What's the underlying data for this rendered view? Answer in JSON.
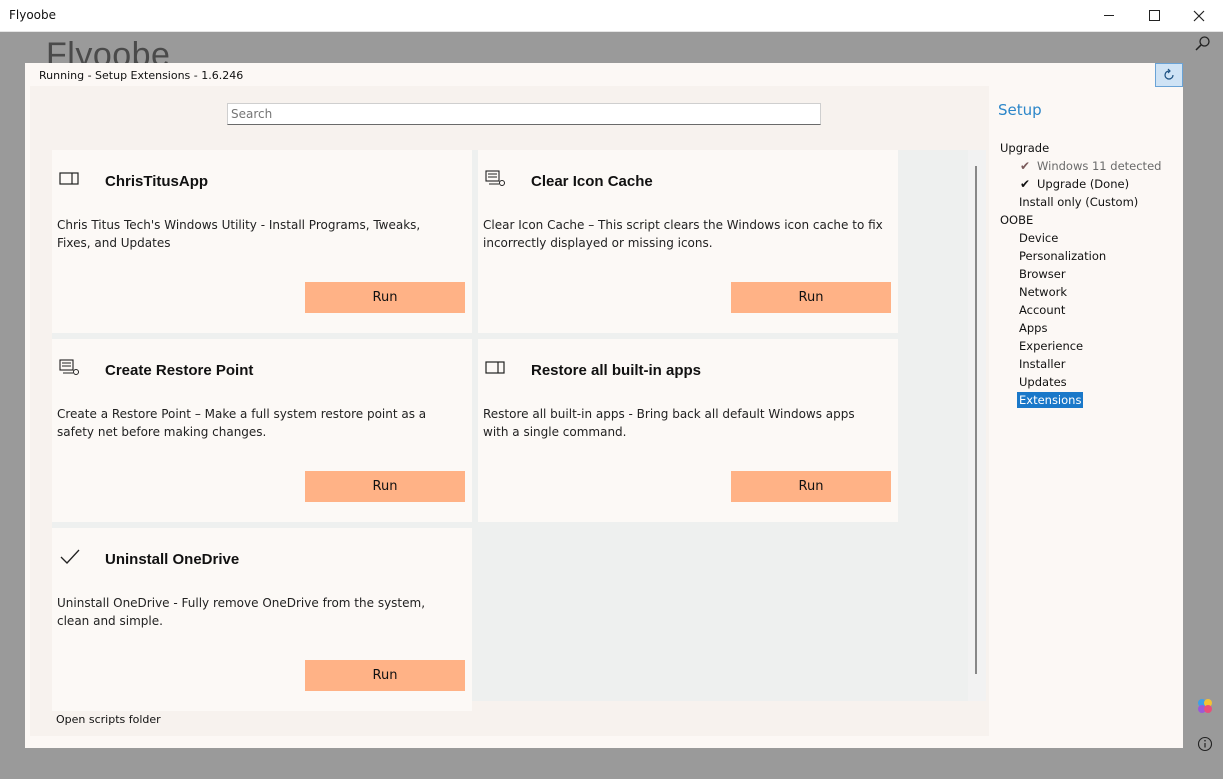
{
  "window": {
    "title": "Flyoobe"
  },
  "background_logo": "Flyoobe",
  "status": {
    "text": "Running - Setup Extensions - 1.6.246"
  },
  "search": {
    "placeholder": "Search"
  },
  "cards": [
    {
      "title": "ChrisTitusApp",
      "icon": "window-icon",
      "description": "Chris Titus Tech's Windows Utility - Install Programs, Tweaks, Fixes, and Updates",
      "run_label": "Run"
    },
    {
      "title": "Clear Icon Cache",
      "icon": "script-icon",
      "description": "Clear  Icon  Cache – This script clears the Windows icon cache to fix incorrectly displayed or missing icons.",
      "run_label": "Run"
    },
    {
      "title": "Create Restore Point",
      "icon": "script-icon",
      "description": "Create a Restore Point – Make a full system restore point as a safety net before making changes.",
      "run_label": "Run"
    },
    {
      "title": "Restore all built-in apps",
      "icon": "window-icon",
      "description": "Restore all built-in apps - Bring back all default Windows apps with a single command.",
      "run_label": "Run"
    },
    {
      "title": "Uninstall OneDrive",
      "icon": "checkmark-icon",
      "description": "Uninstall OneDrive - Fully remove OneDrive from the system, clean and simple.",
      "run_label": "Run"
    }
  ],
  "footer": {
    "open_scripts": "Open scripts folder"
  },
  "sidebar": {
    "header": "Setup",
    "items": [
      {
        "label": "Upgrade"
      },
      {
        "label": "Windows 11 detected"
      },
      {
        "label": "Upgrade (Done)"
      },
      {
        "label": "Install only (Custom)"
      },
      {
        "label": "OOBE"
      },
      {
        "label": "Device"
      },
      {
        "label": "Personalization"
      },
      {
        "label": "Browser"
      },
      {
        "label": "Network"
      },
      {
        "label": "Account"
      },
      {
        "label": "Apps"
      },
      {
        "label": "Experience"
      },
      {
        "label": "Installer"
      },
      {
        "label": "Updates"
      },
      {
        "label": "Extensions"
      }
    ],
    "selected": "Extensions"
  },
  "colors": {
    "accent": "#1a78c9",
    "run_button": "#ffb286",
    "header": "#2c86c9"
  }
}
